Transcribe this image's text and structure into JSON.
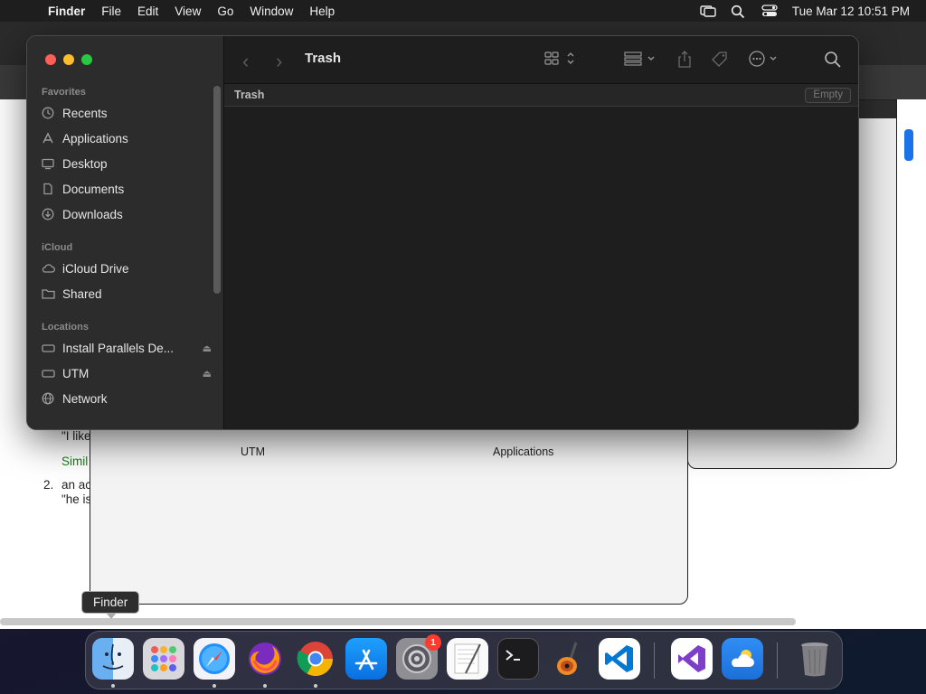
{
  "menubar": {
    "app_name": "Finder",
    "items": [
      "File",
      "Edit",
      "View",
      "Go",
      "Window",
      "Help"
    ],
    "clock": "Tue Mar 12  10:51 PM"
  },
  "background": {
    "text_likes": "\"I like",
    "text_simil": "Simil",
    "text_num": "2.",
    "text_anac": "an ac",
    "text_heis": "\"he is",
    "dialog_labels": [
      "UTM",
      "Applications"
    ]
  },
  "finder": {
    "title": "Trash",
    "path_label": "Trash",
    "empty_button": "Empty",
    "sidebar": {
      "favorites_header": "Favorites",
      "favorites": [
        {
          "label": "Recents",
          "icon": "clock-icon"
        },
        {
          "label": "Applications",
          "icon": "applications-icon"
        },
        {
          "label": "Desktop",
          "icon": "desktop-icon"
        },
        {
          "label": "Documents",
          "icon": "document-icon"
        },
        {
          "label": "Downloads",
          "icon": "download-icon"
        }
      ],
      "icloud_header": "iCloud",
      "icloud": [
        {
          "label": "iCloud Drive",
          "icon": "cloud-icon"
        },
        {
          "label": "Shared",
          "icon": "shared-folder-icon"
        }
      ],
      "locations_header": "Locations",
      "locations": [
        {
          "label": "Install Parallels De...",
          "icon": "disk-icon"
        },
        {
          "label": "UTM",
          "icon": "disk-icon"
        },
        {
          "label": "Network",
          "icon": "globe-icon"
        }
      ]
    }
  },
  "tooltip": "Finder",
  "dock": {
    "apps": [
      "Finder",
      "Launchpad",
      "Safari",
      "Firefox",
      "Chrome",
      "App Store",
      "System Settings",
      "TextEdit",
      "Terminal",
      "GarageBand",
      "Visual Studio Code",
      "Visual Studio",
      "Weather",
      "Trash"
    ],
    "settings_badge": "1"
  }
}
